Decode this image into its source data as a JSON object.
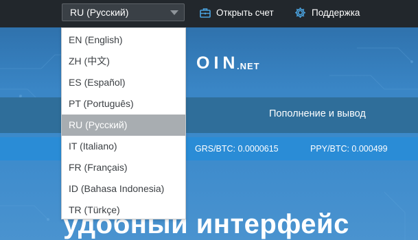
{
  "header": {
    "language_selected": "RU (Русский)",
    "open_account_label": "Открыть счет",
    "support_label": "Поддержка"
  },
  "language_menu": {
    "options": [
      "EN (English)",
      "ZH (中文)",
      "ES (Español)",
      "PT (Português)",
      "RU (Русский)",
      "IT (Italiano)",
      "FR (Français)",
      "ID (Bahasa Indonesia)",
      "TR (Türkçe)"
    ],
    "selected_index": 4
  },
  "hero": {
    "logo_text": "OIN",
    "logo_suffix": ".NET",
    "nav_item": "Пополнение и вывод",
    "rates": {
      "grs": "GRS/BTC: 0.0000615",
      "ppy": "PPY/BTC: 0.000499"
    },
    "headline": "удобный интерфейс"
  },
  "icons": {
    "language_caret": "chevron-down-icon",
    "open_account": "briefcase-icon",
    "support": "gear-icon"
  },
  "colors": {
    "topbar": "#22272c",
    "hero": "#3a86c6",
    "ticker": "#2a8cd6",
    "selected_option": "#a8adb1"
  }
}
